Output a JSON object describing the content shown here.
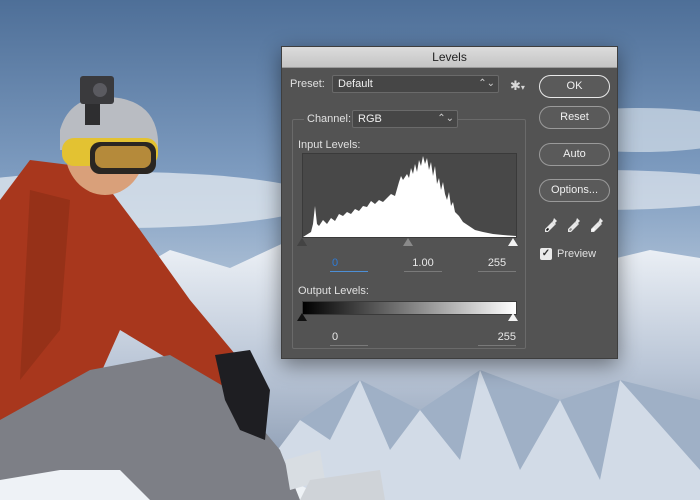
{
  "dialog": {
    "title": "Levels",
    "preset": {
      "label": "Preset:",
      "value": "Default"
    },
    "channel": {
      "label": "Channel:",
      "value": "RGB"
    },
    "input_levels": {
      "label": "Input Levels:",
      "black": "0",
      "gamma": "1.00",
      "white": "255"
    },
    "output_levels": {
      "label": "Output Levels:",
      "black": "0",
      "white": "255"
    },
    "buttons": {
      "ok": "OK",
      "reset": "Reset",
      "auto": "Auto",
      "options": "Options..."
    },
    "preview": {
      "label": "Preview",
      "checked": true
    },
    "icons": {
      "gear": "gear-icon",
      "chevron": "chevron-updown-icon",
      "black_eyedropper": "black-eyedropper-icon",
      "gray_eyedropper": "gray-eyedropper-icon",
      "white_eyedropper": "white-eyedropper-icon"
    }
  },
  "background": {
    "description_colors": {
      "sky": "#7f9cbf",
      "jacket": "#a83a1f",
      "snow": "#dde3ec"
    }
  }
}
